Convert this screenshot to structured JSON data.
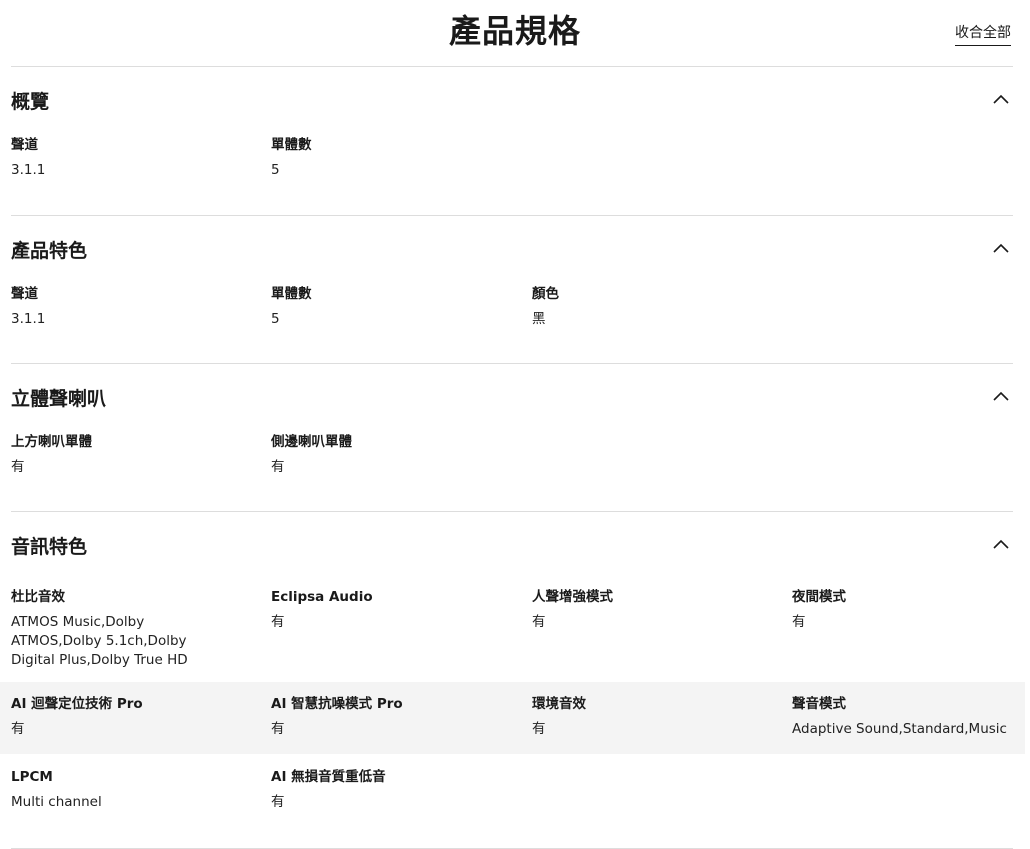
{
  "header": {
    "title": "產品規格",
    "collapse_all_label": "收合全部"
  },
  "sections": [
    {
      "title": "概覽",
      "specs": [
        {
          "label": "聲道",
          "value": "3.1.1"
        },
        {
          "label": "單體數",
          "value": "5"
        }
      ]
    },
    {
      "title": "產品特色",
      "specs": [
        {
          "label": "聲道",
          "value": "3.1.1"
        },
        {
          "label": "單體數",
          "value": "5"
        },
        {
          "label": "顏色",
          "value": "黑"
        }
      ]
    },
    {
      "title": "立體聲喇叭",
      "specs": [
        {
          "label": "上方喇叭單體",
          "value": "有"
        },
        {
          "label": "側邊喇叭單體",
          "value": "有"
        }
      ]
    },
    {
      "title": "音訊特色",
      "specs": [
        {
          "label": "杜比音效",
          "value": "ATMOS Music,Dolby ATMOS,Dolby 5.1ch,Dolby Digital Plus,Dolby True HD"
        },
        {
          "label": "Eclipsa Audio",
          "value": "有"
        },
        {
          "label": "人聲增強模式",
          "value": "有"
        },
        {
          "label": "夜間模式",
          "value": "有"
        },
        {
          "label": "AI 迴聲定位技術 Pro",
          "value": "有"
        },
        {
          "label": "AI 智慧抗噪模式 Pro",
          "value": "有"
        },
        {
          "label": "環境音效",
          "value": "有"
        },
        {
          "label": "聲音模式",
          "value": "Adaptive Sound,Standard,Music"
        },
        {
          "label": "LPCM",
          "value": "Multi channel"
        },
        {
          "label": "AI 無損音質重低音",
          "value": "有"
        }
      ]
    }
  ],
  "icons": {
    "section_toggle": "chevron-up-icon"
  },
  "colors": {
    "divider": "#dddddd",
    "row_shade": "#f4f4f4",
    "text": "#1a1a1a"
  }
}
